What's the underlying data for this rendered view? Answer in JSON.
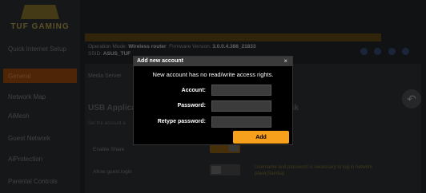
{
  "sidebar": {
    "logo": "TUF GAMING",
    "items": [
      {
        "label": "Quick Internet Setup",
        "active": false
      },
      {
        "label": "General",
        "active": true
      },
      {
        "label": "Network Map",
        "active": false
      },
      {
        "label": "AiMesh",
        "active": false
      },
      {
        "label": "Guest Network",
        "active": false
      },
      {
        "label": "AiProtection",
        "active": false
      },
      {
        "label": "Parental Controls",
        "active": false
      }
    ]
  },
  "header": {
    "operation_mode_label": "Operation Mode:",
    "operation_mode": "Wireless router",
    "firmware_label": "Firmware Version:",
    "firmware": "3.0.0.4.388_21833",
    "ssid_label": "SSID:",
    "ssid": "ASUS_TUF"
  },
  "main": {
    "tabs": "Media Server",
    "section_title": "USB Applica",
    "section_title2": "sk",
    "set_desc": "Set the account a",
    "rows": [
      "Enable Share",
      "Allow guest login"
    ],
    "guest_note": "Username and password is necessary to log in network place(Samba)"
  },
  "modal": {
    "title": "Add new account",
    "close_glyph": "×",
    "message": "New account has no read/write access rights.",
    "account_label": "Account:",
    "account_value": "",
    "password_label": "Password:",
    "password_value": "",
    "retype_label": "Retype password:",
    "retype_value": "",
    "add_label": "Add"
  },
  "colors": {
    "accent": "#f7a01b",
    "modal_bg": "#000000",
    "header_bg": "#3a3a3a"
  }
}
